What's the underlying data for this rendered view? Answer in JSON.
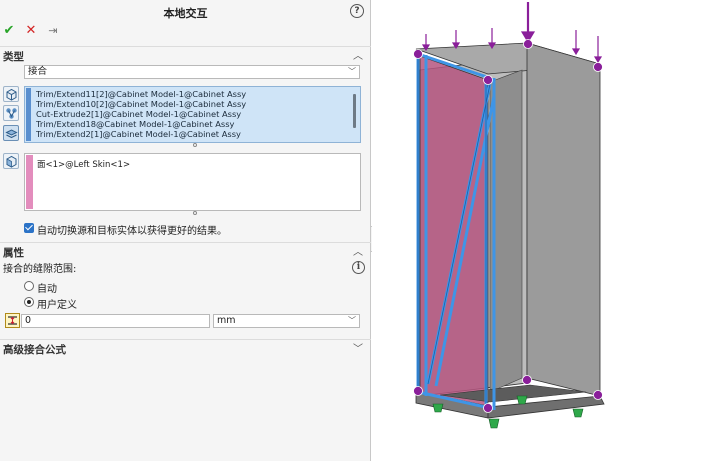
{
  "panel": {
    "title": "本地交互",
    "help_glyph": "?"
  },
  "actions": {
    "ok_glyph": "✔",
    "cancel_glyph": "✕",
    "pin_glyph": "⇥"
  },
  "type_section": {
    "title": "类型",
    "chevron": "︿",
    "mate_type": "接合",
    "arrow": "﹀"
  },
  "selections": {
    "items": [
      "Trim/Extend11[2]@Cabinet Model-1@Cabinet Assy",
      "Trim/Extend10[2]@Cabinet Model-1@Cabinet Assy",
      "Cut-Extrude2[1]@Cabinet Model-1@Cabinet Assy",
      "Trim/Extend18@Cabinet Model-1@Cabinet Assy",
      "Trim/Extend2[1]@Cabinet Model-1@Cabinet Assy"
    ],
    "target_face": "面<1>@Left Skin<1>",
    "auto_switch_label": "自动切换源和目标实体以获得更好的结果。"
  },
  "properties": {
    "title": "属性",
    "chevron": "︿",
    "clearance_label": "接合的缝隙范围:",
    "info_glyph": "i",
    "auto_label": "自动",
    "user_defined_label": "用户定义",
    "gap_value": "0",
    "unit": "mm",
    "unit_arrow": "﹀"
  },
  "advanced": {
    "title": "高级接合公式",
    "chevron": "﹀"
  },
  "colors": {
    "accent": "#2b73c7",
    "selection_bg": "#cfe4f7",
    "face_strip": "#e38dbd",
    "cabinet_pink": "#b5557f",
    "frame_blue": "#3f95e6",
    "marker_purple": "#8a1f9a",
    "support_green": "#2fa84a"
  }
}
